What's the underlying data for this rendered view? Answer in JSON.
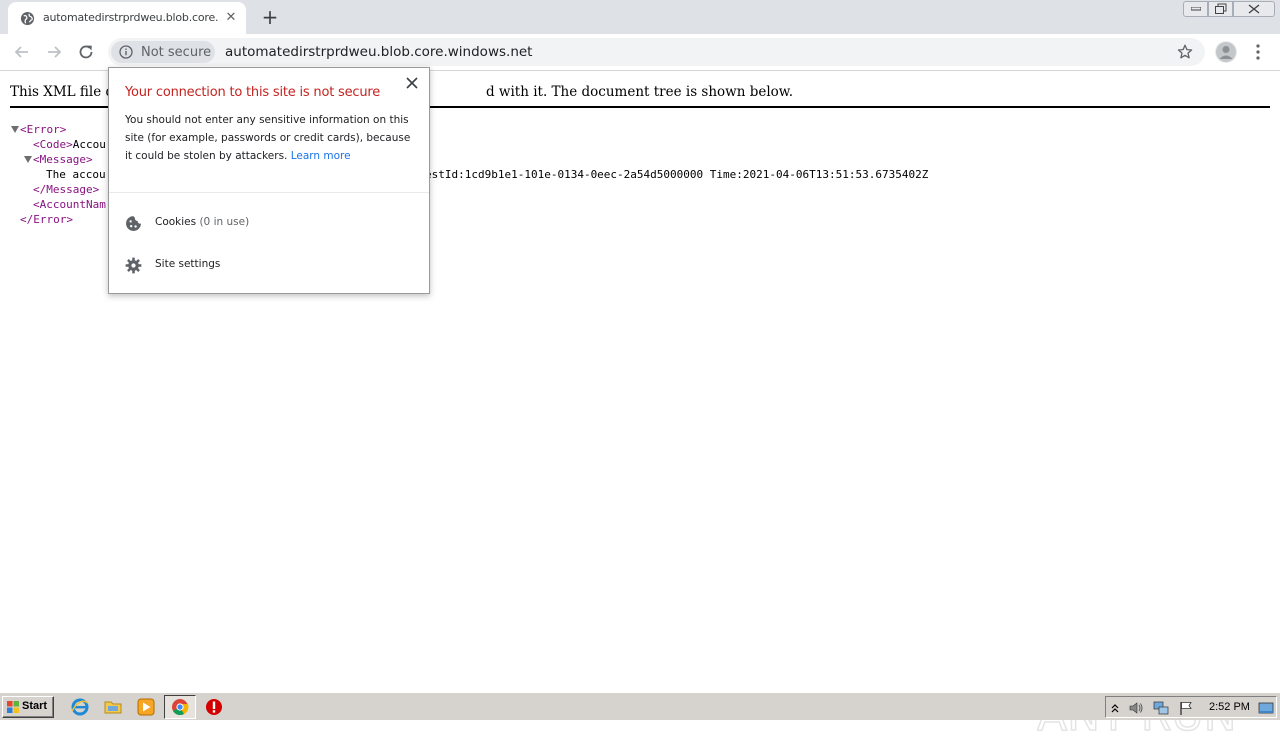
{
  "browser": {
    "tab": {
      "title": "automatedirstrprdweu.blob.core.windows.net",
      "close_glyph": "✕",
      "favicon": "globe-icon"
    },
    "new_tab_glyph": "+",
    "toolbar": {
      "security_label": "Not secure",
      "url": "automatedirstrprdweu.blob.core.windows.net"
    }
  },
  "page": {
    "xml_header_left": "This XML file do",
    "xml_header_right": "d with it. The document tree is shown below.",
    "xml_lines": [
      {
        "open_tag": "<Error>",
        "text": "",
        "close_tag": ""
      },
      {
        "open_tag": "<Code>",
        "text": "Accou",
        "close_tag": ""
      },
      {
        "open_tag": "<Message>",
        "text": "",
        "close_tag": ""
      },
      {
        "open_tag": "",
        "text": "The accou",
        "close_tag": ""
      },
      {
        "open_tag": "",
        "text": "",
        "close_tag": "</Message>"
      },
      {
        "open_tag": "<AccountNam",
        "text": "",
        "close_tag": ""
      },
      {
        "open_tag": "",
        "text": "",
        "close_tag": "</Error>"
      }
    ],
    "message_tail": "estId:1cd9b1e1-101e-0134-0eec-2a54d5000000 Time:2021-04-06T13:51:53.6735402Z"
  },
  "popup": {
    "title": "Your connection to this site is not secure",
    "description": "You should not enter any sensitive information on this site (for example, passwords or credit cards), because it could be stolen by attackers.",
    "learn_more": "Learn more",
    "cookies_label": "Cookies",
    "cookies_sub": "(0 in use)",
    "site_settings_label": "Site settings",
    "close_glyph": "✕"
  },
  "watermark": {
    "text": "ANY RUN"
  },
  "taskbar": {
    "start_label": "Start",
    "clock": "2:52 PM",
    "pinned": [
      "internet-explorer-icon",
      "folder-icon",
      "media-player-icon",
      "chrome-icon",
      "stop-icon"
    ]
  },
  "colors": {
    "xml_tag": "#881280",
    "popup_title": "#c5221f",
    "link": "#1a73e8",
    "tabstrip": "#dee1e6",
    "taskbar": "#d6d3ce"
  }
}
